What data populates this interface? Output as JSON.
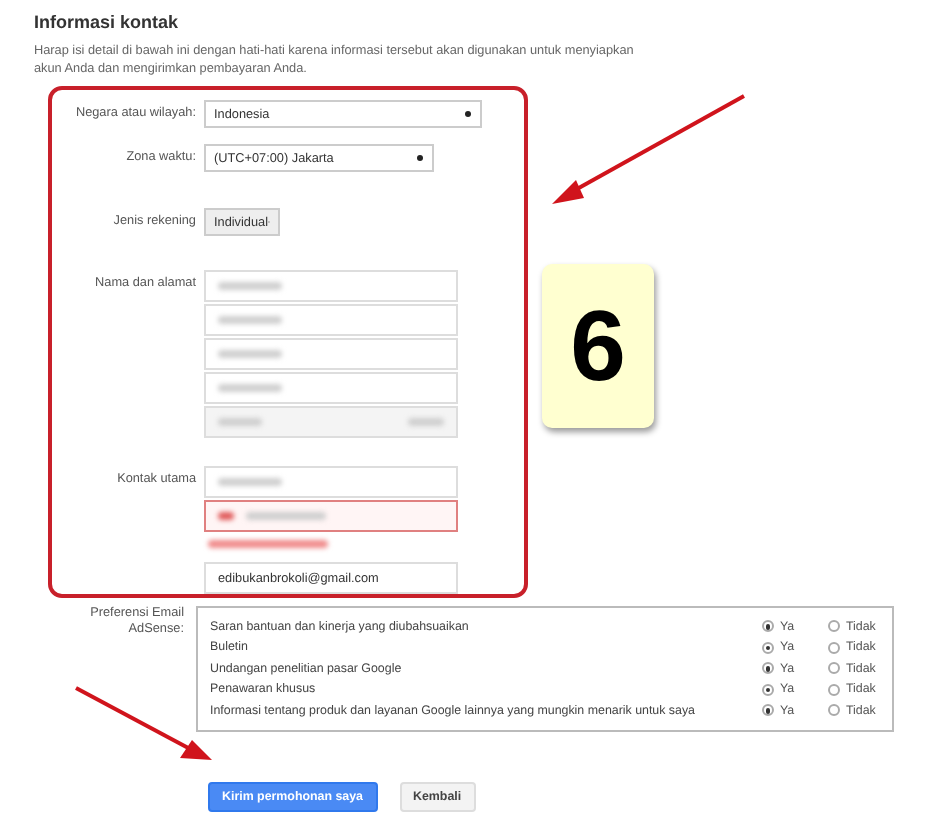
{
  "section": {
    "title": "Informasi kontak",
    "intro": "Harap isi detail di bawah ini dengan hati-hati karena informasi tersebut akan digunakan untuk menyiapkan akun Anda dan mengirimkan pembayaran Anda."
  },
  "form": {
    "country": {
      "label": "Negara atau wilayah:",
      "value": "Indonesia"
    },
    "timezone": {
      "label": "Zona waktu:",
      "value": "(UTC+07:00) Jakarta"
    },
    "account_type": {
      "label": "Jenis rekening",
      "value": "Individual"
    },
    "name_address": {
      "label": "Nama dan alamat",
      "fields": [
        {
          "kind": "input",
          "redacted": true
        },
        {
          "kind": "input",
          "redacted": true
        },
        {
          "kind": "input",
          "redacted": true
        },
        {
          "kind": "input",
          "redacted": true
        },
        {
          "kind": "split",
          "redacted": true
        }
      ]
    },
    "contact": {
      "label": "Kontak utama",
      "fields": [
        {
          "kind": "input",
          "redacted": true,
          "error": false
        },
        {
          "kind": "phone",
          "redacted": true,
          "error": true
        }
      ],
      "email": "edibukanbrokoli@gmail.com"
    }
  },
  "preferences": {
    "label": "Preferensi Email AdSense:",
    "items": [
      {
        "text": "Saran bantuan dan kinerja yang diubahsuaikan",
        "yes_label": "Ya",
        "no_label": "Tidak",
        "yes_selected": true
      },
      {
        "text": "Buletin",
        "yes_label": "Ya",
        "no_label": "Tidak",
        "yes_selected": true
      },
      {
        "text": "Undangan penelitian pasar Google",
        "yes_label": "Ya",
        "no_label": "Tidak",
        "yes_selected": true
      },
      {
        "text": "Penawaran khusus",
        "yes_label": "Ya",
        "no_label": "Tidak",
        "yes_selected": true
      },
      {
        "text": "Informasi tentang produk dan layanan Google lainnya yang mungkin menarik untuk saya",
        "yes_label": "Ya",
        "no_label": "Tidak",
        "yes_selected": true
      }
    ]
  },
  "buttons": [
    {
      "label": "Kirim permohonan saya",
      "kind": "primary"
    },
    {
      "label": "Kembali",
      "kind": "secondary"
    }
  ],
  "step_badge": "6"
}
